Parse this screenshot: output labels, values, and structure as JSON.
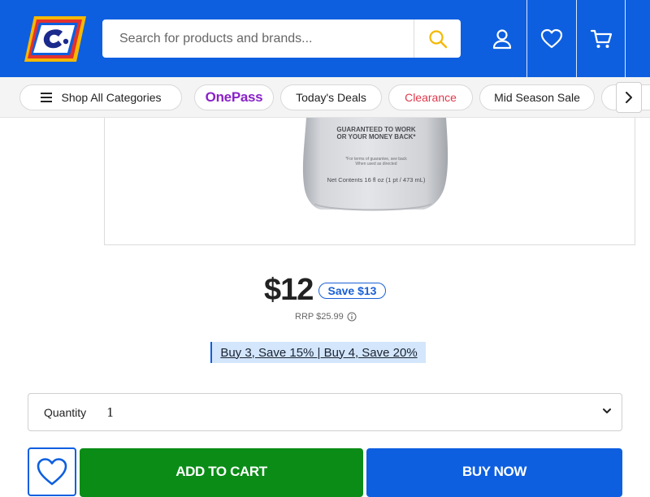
{
  "header": {
    "search_placeholder": "Search for products and brands...",
    "colors": {
      "brand_blue": "#0d5fe0",
      "accent_yellow": "#f5b800"
    },
    "icons": [
      "catch-logo-icon",
      "search-icon",
      "user-icon",
      "heart-icon",
      "cart-icon"
    ]
  },
  "nav": {
    "shop_all": "Shop All Categories",
    "pills": [
      {
        "label": "OnePass",
        "color": "#8a22c9"
      },
      {
        "label": "Today's Deals",
        "color": "#222222"
      },
      {
        "label": "Clearance",
        "color": "#e0384b"
      },
      {
        "label": "Mid Season Sale",
        "color": "#222222"
      }
    ],
    "next_arrow_icon": "chevron-right-icon"
  },
  "product": {
    "bottle_text": {
      "guarantee_line1": "GUARANTEED TO WORK",
      "guarantee_line2": "OR YOUR MONEY BACK*",
      "fine1": "*For terms of guarantee, see back",
      "fine2": "When used as directed",
      "net_contents": "Net Contents 16 fl oz (1 pt / 473 mL)"
    },
    "price": "$12",
    "save": "Save $13",
    "rrp": "RRP $25.99",
    "promo": "Buy 3, Save 15% | Buy 4, Save 20%",
    "quantity_label": "Quantity",
    "quantity_value": "1",
    "add_to_cart": "ADD TO CART",
    "buy_now": "BUY NOW",
    "colors": {
      "add_to_cart": "#0a8c17",
      "buy_now": "#0d5fe0",
      "save_badge": "#1a5fd6"
    }
  }
}
